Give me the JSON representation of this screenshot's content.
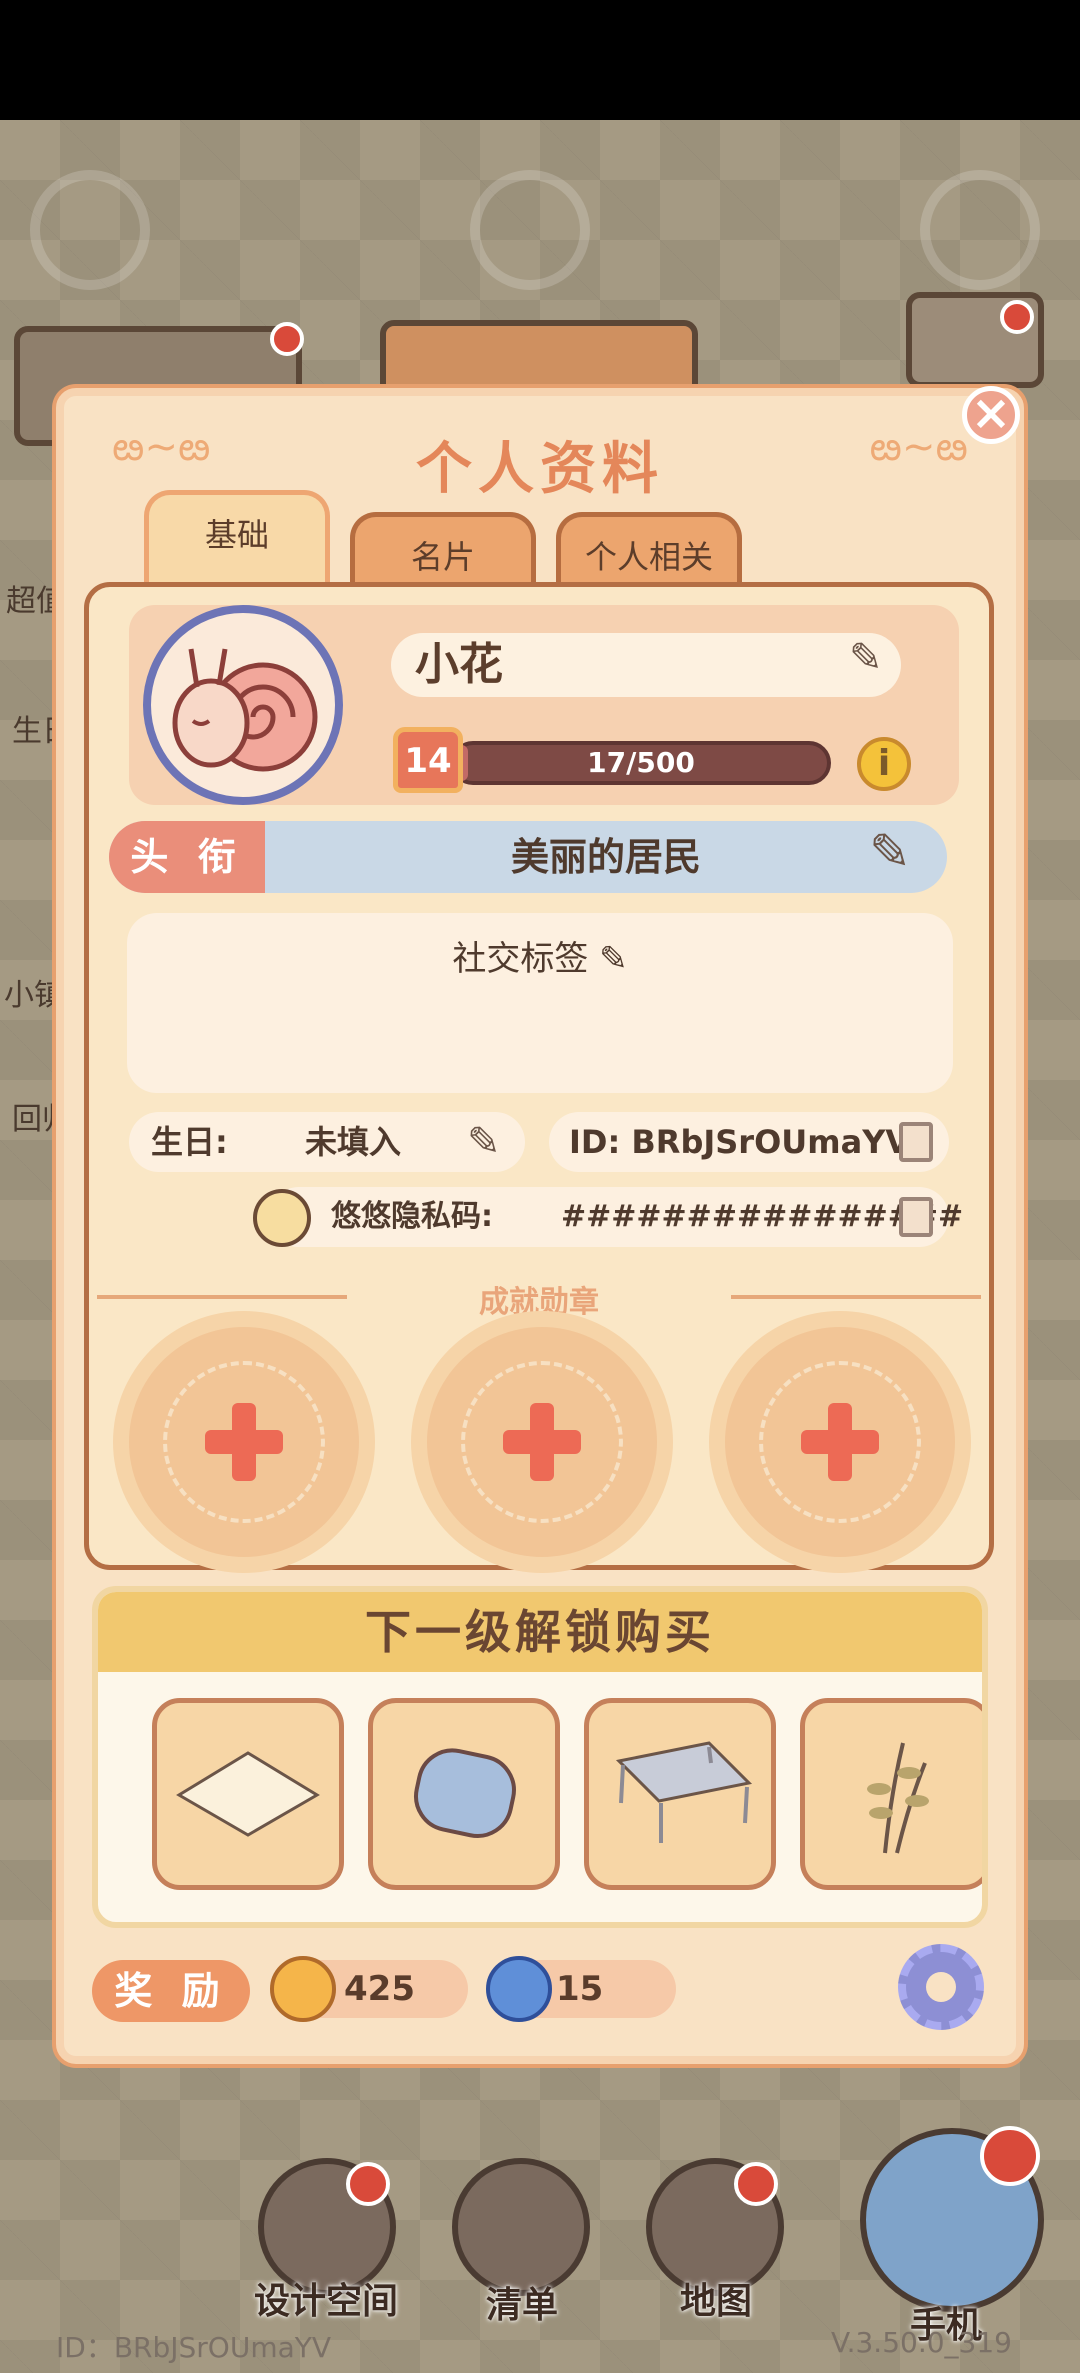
{
  "panel": {
    "title": "个人资料",
    "tabs": [
      {
        "label": "基础",
        "active": true
      },
      {
        "label": "名片",
        "active": false
      },
      {
        "label": "个人相关",
        "active": false
      }
    ]
  },
  "profile": {
    "name": "小花",
    "level": "14",
    "xp_text": "17/500",
    "xp_progress": 0.034,
    "title_label": "头 衔",
    "title_value": "美丽的居民",
    "social_tags_label": "社交标签",
    "birthday_label": "生日:",
    "birthday_value": "未填入",
    "id_text": "ID: BRbJSrOUmaYV",
    "private_code_label": "悠悠隐私码:",
    "private_code_value": "################"
  },
  "achievements": {
    "header": "成就勋章"
  },
  "unlock": {
    "header": "下一级解锁购买",
    "items": [
      "rug-icon",
      "cushion-icon",
      "table-icon",
      "plant-icon"
    ]
  },
  "rewards": {
    "label": "奖 励",
    "coins": "425",
    "gems": "15"
  },
  "background": {
    "side_labels": [
      "超值",
      "生日",
      "小镇",
      "回归"
    ]
  },
  "dock": {
    "design_space": "设计空间",
    "list": "清单",
    "map": "地图",
    "phone": "手机"
  },
  "footer": {
    "id": "ID：BRbJSrOUmaYV",
    "version": "V.3.50.0_319"
  },
  "colors": {
    "panel_bg": "#f9e2c4",
    "accent": "#e4875a",
    "title_banner": "#c9d8e6",
    "notification": "#d94a3a"
  }
}
